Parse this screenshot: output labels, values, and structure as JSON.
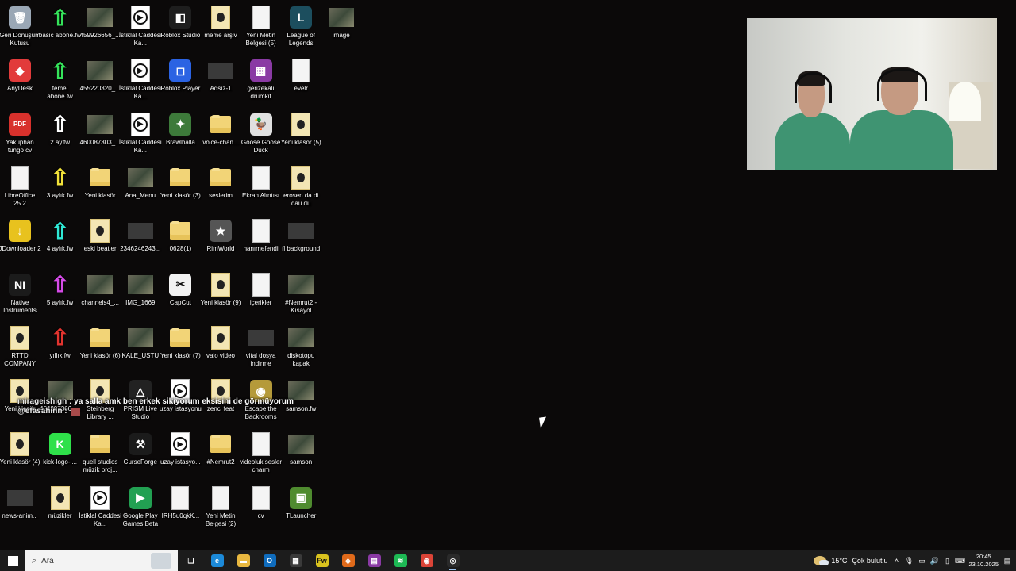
{
  "desktop_icons": [
    {
      "label": "Geri Dönüşüm Kutusu",
      "type": "app",
      "color": "#9aa7b5",
      "glyph": "🗑",
      "col": 0,
      "row": 0
    },
    {
      "label": "basic abone.fw",
      "type": "arrow",
      "color": "#35e35a",
      "col": 1,
      "row": 0
    },
    {
      "label": "459926656_...",
      "type": "photo",
      "col": 2,
      "row": 0
    },
    {
      "label": "İstiklal Caddesi Ka...",
      "type": "video",
      "col": 3,
      "row": 0
    },
    {
      "label": "Roblox Studio",
      "type": "app",
      "color": "#1e1e1e",
      "glyph": "◧",
      "col": 4,
      "row": 0
    },
    {
      "label": "meme arşiv",
      "type": "folderp",
      "col": 5,
      "row": 0
    },
    {
      "label": "Yeni Metin Belgesi (5)",
      "type": "doc",
      "col": 6,
      "row": 0
    },
    {
      "label": "League of Legends",
      "type": "app",
      "color": "#1c4e5e",
      "glyph": "L",
      "col": 7,
      "row": 0
    },
    {
      "label": "image",
      "type": "photo",
      "col": 8,
      "row": 0
    },
    {
      "label": "AnyDesk",
      "type": "app",
      "color": "#e23b3b",
      "glyph": "◆",
      "col": 0,
      "row": 1
    },
    {
      "label": "temel abone.fw",
      "type": "arrow",
      "color": "#35e35a",
      "col": 1,
      "row": 1
    },
    {
      "label": "455220320_...",
      "type": "photo",
      "col": 2,
      "row": 1
    },
    {
      "label": "İstiklal Caddesi Ka...",
      "type": "video",
      "col": 3,
      "row": 1
    },
    {
      "label": "Roblox Player",
      "type": "app",
      "color": "#2b63e3",
      "glyph": "◻",
      "col": 4,
      "row": 1
    },
    {
      "label": "Adsız-1",
      "type": "gray",
      "col": 5,
      "row": 1
    },
    {
      "label": "gerizekalı drumkit",
      "type": "app",
      "color": "#8a3aa4",
      "glyph": "▦",
      "col": 6,
      "row": 1
    },
    {
      "label": "evelr",
      "type": "doc",
      "col": 7,
      "row": 1
    },
    {
      "label": "Yakuphan tungo cv",
      "type": "app",
      "color": "#d8312c",
      "glyph": "PDF",
      "col": 0,
      "row": 2
    },
    {
      "label": "2.ay.fw",
      "type": "arrow",
      "color": "#ffffff",
      "col": 1,
      "row": 2
    },
    {
      "label": "460087303_...",
      "type": "photo",
      "col": 2,
      "row": 2
    },
    {
      "label": "İstiklal Caddesi Ka...",
      "type": "video",
      "col": 3,
      "row": 2
    },
    {
      "label": "Brawlhalla",
      "type": "app",
      "color": "#3d7a3a",
      "glyph": "✦",
      "col": 4,
      "row": 2
    },
    {
      "label": "voice-chan...",
      "type": "folder",
      "col": 5,
      "row": 2
    },
    {
      "label": "Goose Goose Duck",
      "type": "app",
      "color": "#e0e0e0",
      "glyph": "🦆",
      "col": 6,
      "row": 2
    },
    {
      "label": "Yeni klasör (5)",
      "type": "folderp",
      "col": 7,
      "row": 2
    },
    {
      "label": "LibreOffice 25.2",
      "type": "doc",
      "col": 0,
      "row": 3
    },
    {
      "label": "3 aylık.fw",
      "type": "arrow",
      "color": "#f2e23a",
      "col": 1,
      "row": 3
    },
    {
      "label": "Yeni klasör",
      "type": "folder",
      "col": 2,
      "row": 3
    },
    {
      "label": "Ana_Menu",
      "type": "photo",
      "col": 3,
      "row": 3
    },
    {
      "label": "Yeni klasör (3)",
      "type": "folder",
      "col": 4,
      "row": 3
    },
    {
      "label": "seslerim",
      "type": "folder",
      "col": 5,
      "row": 3
    },
    {
      "label": "Ekran Alıntısı",
      "type": "doc",
      "col": 6,
      "row": 3
    },
    {
      "label": "erosen da di dau du",
      "type": "folderp",
      "col": 7,
      "row": 3
    },
    {
      "label": "JDownloader 2",
      "type": "app",
      "color": "#e8c21e",
      "glyph": "↓",
      "col": 0,
      "row": 4
    },
    {
      "label": "4 aylık.fw",
      "type": "arrow",
      "color": "#2fe8d5",
      "col": 1,
      "row": 4
    },
    {
      "label": "eski beatler",
      "type": "folderp",
      "col": 2,
      "row": 4
    },
    {
      "label": "2346246243...",
      "type": "gray",
      "col": 3,
      "row": 4
    },
    {
      "label": "0628(1)",
      "type": "folder",
      "col": 4,
      "row": 4
    },
    {
      "label": "RimWorld",
      "type": "app",
      "color": "#555",
      "glyph": "★",
      "col": 5,
      "row": 4
    },
    {
      "label": "hanımefendi",
      "type": "doc",
      "col": 6,
      "row": 4
    },
    {
      "label": "fl background",
      "type": "gray",
      "col": 7,
      "row": 4
    },
    {
      "label": "Native Instruments",
      "type": "app",
      "color": "#1b1b1b",
      "glyph": "NI",
      "col": 0,
      "row": 5
    },
    {
      "label": "5 aylık.fw",
      "type": "arrow",
      "color": "#d64be8",
      "col": 1,
      "row": 5
    },
    {
      "label": "channels4_...",
      "type": "photo",
      "col": 2,
      "row": 5
    },
    {
      "label": "IMG_1669",
      "type": "photo",
      "col": 3,
      "row": 5
    },
    {
      "label": "CapCut",
      "type": "app",
      "color": "#f2f2f2",
      "glyph": "✂",
      "col": 4,
      "row": 5
    },
    {
      "label": "Yeni klasör (9)",
      "type": "folderp",
      "col": 5,
      "row": 5
    },
    {
      "label": "içerikler",
      "type": "doc",
      "col": 6,
      "row": 5
    },
    {
      "label": "#Nemrut2 - Kısayol",
      "type": "photo",
      "col": 7,
      "row": 5
    },
    {
      "label": "RTTD COMPANY",
      "type": "folderp",
      "col": 0,
      "row": 6
    },
    {
      "label": "yıllık.fw",
      "type": "arrow",
      "color": "#e3342f",
      "col": 1,
      "row": 6
    },
    {
      "label": "Yeni klasör (6)",
      "type": "folder",
      "col": 2,
      "row": 6
    },
    {
      "label": "KALE_USTU",
      "type": "photo",
      "col": 3,
      "row": 6
    },
    {
      "label": "Yeni klasör (7)",
      "type": "folder",
      "col": 4,
      "row": 6
    },
    {
      "label": "valo video",
      "type": "folderp",
      "col": 5,
      "row": 6
    },
    {
      "label": "vital dosya indirme",
      "type": "gray",
      "col": 6,
      "row": 6
    },
    {
      "label": "diskotopu kapak",
      "type": "photo",
      "col": 7,
      "row": 6
    },
    {
      "label": "Yeni klasör",
      "type": "folderp",
      "col": 0,
      "row": 7
    },
    {
      "label": "454207366_...",
      "type": "photo",
      "col": 1,
      "row": 7
    },
    {
      "label": "Steinberg Library ...",
      "type": "folderp",
      "col": 2,
      "row": 7
    },
    {
      "label": "PRISM Live Studio",
      "type": "app",
      "color": "#222",
      "glyph": "△",
      "col": 3,
      "row": 7
    },
    {
      "label": "uzay istasyonu",
      "type": "video",
      "col": 4,
      "row": 7
    },
    {
      "label": "zenci feat",
      "type": "folderp",
      "col": 5,
      "row": 7
    },
    {
      "label": "Escape the Backrooms",
      "type": "app",
      "color": "#b59a3a",
      "glyph": "◉",
      "col": 6,
      "row": 7
    },
    {
      "label": "samson.fw",
      "type": "photo",
      "col": 7,
      "row": 7
    },
    {
      "label": "Yeni klasör (4)",
      "type": "folderp",
      "col": 0,
      "row": 8
    },
    {
      "label": "kick-logo-i...",
      "type": "app",
      "color": "#2fe04a",
      "glyph": "K",
      "col": 1,
      "row": 8
    },
    {
      "label": "quell studios müzik proj...",
      "type": "folder",
      "col": 2,
      "row": 8
    },
    {
      "label": "CurseForge",
      "type": "app",
      "color": "#1b1b1b",
      "glyph": "⚒",
      "col": 3,
      "row": 8
    },
    {
      "label": "uzay istasyo...",
      "type": "video",
      "col": 4,
      "row": 8
    },
    {
      "label": "#Nemrut2",
      "type": "folder",
      "col": 5,
      "row": 8
    },
    {
      "label": "videoluk sesler charm",
      "type": "doc",
      "col": 6,
      "row": 8
    },
    {
      "label": "samson",
      "type": "photo",
      "col": 7,
      "row": 8
    },
    {
      "label": "news-anim...",
      "type": "gray",
      "col": 0,
      "row": 9
    },
    {
      "label": "müzikler",
      "type": "folderp",
      "col": 1,
      "row": 9
    },
    {
      "label": "İstiklal Caddesi Ka...",
      "type": "video",
      "col": 2,
      "row": 9
    },
    {
      "label": "Google Play Games Beta",
      "type": "app",
      "color": "#22a052",
      "glyph": "▶",
      "col": 3,
      "row": 9
    },
    {
      "label": "IRH5u0qkK...",
      "type": "doc",
      "col": 4,
      "row": 9
    },
    {
      "label": "Yeni Metin Belgesi (2)",
      "type": "doc",
      "col": 5,
      "row": 9
    },
    {
      "label": "cv",
      "type": "doc",
      "col": 6,
      "row": 9
    },
    {
      "label": "TLauncher",
      "type": "app",
      "color": "#4f8b2f",
      "glyph": "▣",
      "col": 7,
      "row": 9
    }
  ],
  "chat": {
    "line1_user": "mirageishigh",
    "line1_text": " : ya salla amk ben erkek sikiyorum eksisini de görmüyorum",
    "line2_user": "@efasahinn :"
  },
  "taskbar": {
    "search_placeholder": "Ara",
    "apps": [
      {
        "name": "task-view",
        "glyph": "❏",
        "color": "transparent"
      },
      {
        "name": "edge",
        "glyph": "e",
        "color": "#1c8ad9"
      },
      {
        "name": "file-explorer",
        "glyph": "▬",
        "color": "#e9b840"
      },
      {
        "name": "outlook",
        "glyph": "O",
        "color": "#0f6cbd"
      },
      {
        "name": "store",
        "glyph": "▦",
        "color": "#3a3a3a"
      },
      {
        "name": "fl-studio",
        "glyph": "Fw",
        "color": "#d9c21e"
      },
      {
        "name": "shield-app",
        "glyph": "◈",
        "color": "#e06a1a"
      },
      {
        "name": "winrar",
        "glyph": "▤",
        "color": "#8a3aa4"
      },
      {
        "name": "spotify",
        "glyph": "≋",
        "color": "#1db954"
      },
      {
        "name": "chrome",
        "glyph": "◉",
        "color": "#db4437"
      },
      {
        "name": "obs",
        "glyph": "◎",
        "color": "#2a2a2a",
        "active": true
      }
    ],
    "weather_temp": "15°C",
    "weather_text": "Çok bulutlu",
    "time": "20:45",
    "date": "23.10.2025"
  }
}
